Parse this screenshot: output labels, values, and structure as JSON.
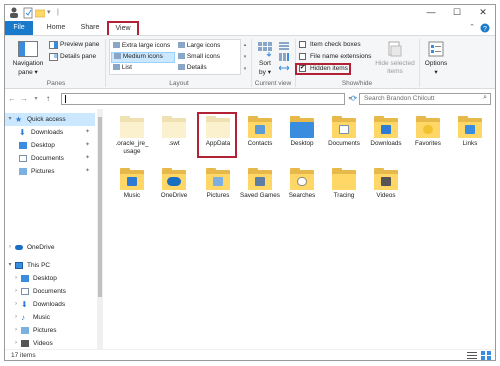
{
  "ribbon_tabs": [
    {
      "label": "File"
    },
    {
      "label": "Home"
    },
    {
      "label": "Share"
    },
    {
      "label": "View"
    }
  ],
  "ribbon": {
    "panes": {
      "navigation_pane": "Navigation",
      "navigation_pane_2": "pane ▾",
      "preview_pane": "Preview pane",
      "details_pane": "Details pane",
      "group_label": "Panes"
    },
    "layout": {
      "options": [
        "Extra large icons",
        "Large icons",
        "Medium icons",
        "Small icons",
        "List",
        "Details"
      ],
      "selected": "Medium icons",
      "group_label": "Layout"
    },
    "current_view": {
      "sort_by": "Sort",
      "sort_by_2": "by ▾",
      "group_label": "Current view"
    },
    "show_hide": {
      "item_check_boxes": "Item check boxes",
      "file_name_extensions": "File name extensions",
      "hidden_items": "Hidden items",
      "hide_selected": "Hide selected",
      "hide_selected_2": "items",
      "group_label": "Show/hide"
    },
    "options": {
      "label": "Options",
      "arrow": "▾"
    }
  },
  "search": {
    "placeholder": "Search Brandon Chilcutt"
  },
  "nav": {
    "quick_access": "Quick access",
    "quick_items": [
      "Downloads",
      "Desktop",
      "Documents",
      "Pictures"
    ],
    "onedrive": "OneDrive",
    "this_pc": "This PC",
    "pc_items": [
      "Desktop",
      "Documents",
      "Downloads",
      "Music",
      "Pictures",
      "Videos"
    ]
  },
  "files": [
    ".oracle_jre_ usage",
    ".swt",
    "AppData",
    "Contacts",
    "Desktop",
    "Documents",
    "Downloads",
    "Favorites",
    "Links",
    "Music",
    "OneDrive",
    "Pictures",
    "Saved Games",
    "Searches",
    "Tracing",
    "Videos"
  ],
  "status": {
    "count": "17 items"
  },
  "colors": {
    "accent": "#1979ca",
    "highlight": "#b22234",
    "folder": "#ffd766"
  }
}
